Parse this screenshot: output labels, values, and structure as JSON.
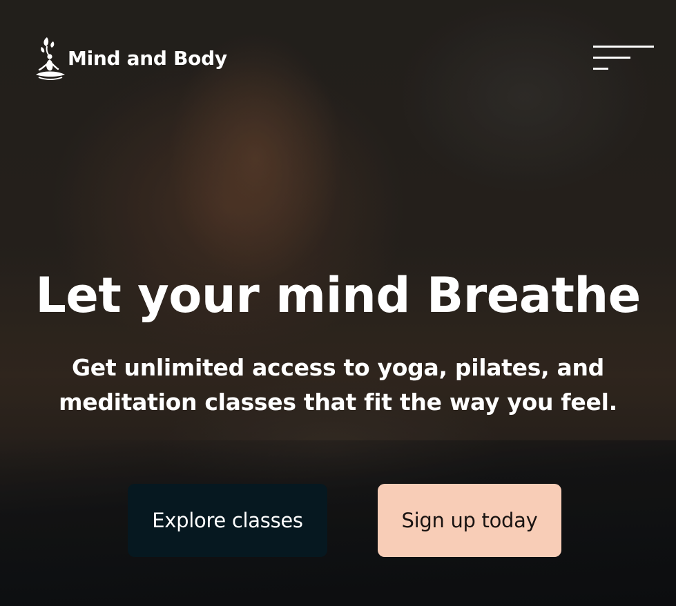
{
  "brand": {
    "name": "Mind and Body",
    "logo_icon": "meditating-figure-leaves-icon"
  },
  "nav": {
    "menu_icon": "hamburger-menu-icon"
  },
  "hero": {
    "headline": "Let your mind Breathe",
    "subheadline": "Get unlimited access to yoga, pilates, and meditation classes that fit the way you feel."
  },
  "actions": {
    "explore_label": "Explore classes",
    "signup_label": "Sign up today"
  },
  "colors": {
    "explore_bg": "#061820",
    "signup_bg": "#f8cdb7",
    "text": "#ffffff"
  }
}
